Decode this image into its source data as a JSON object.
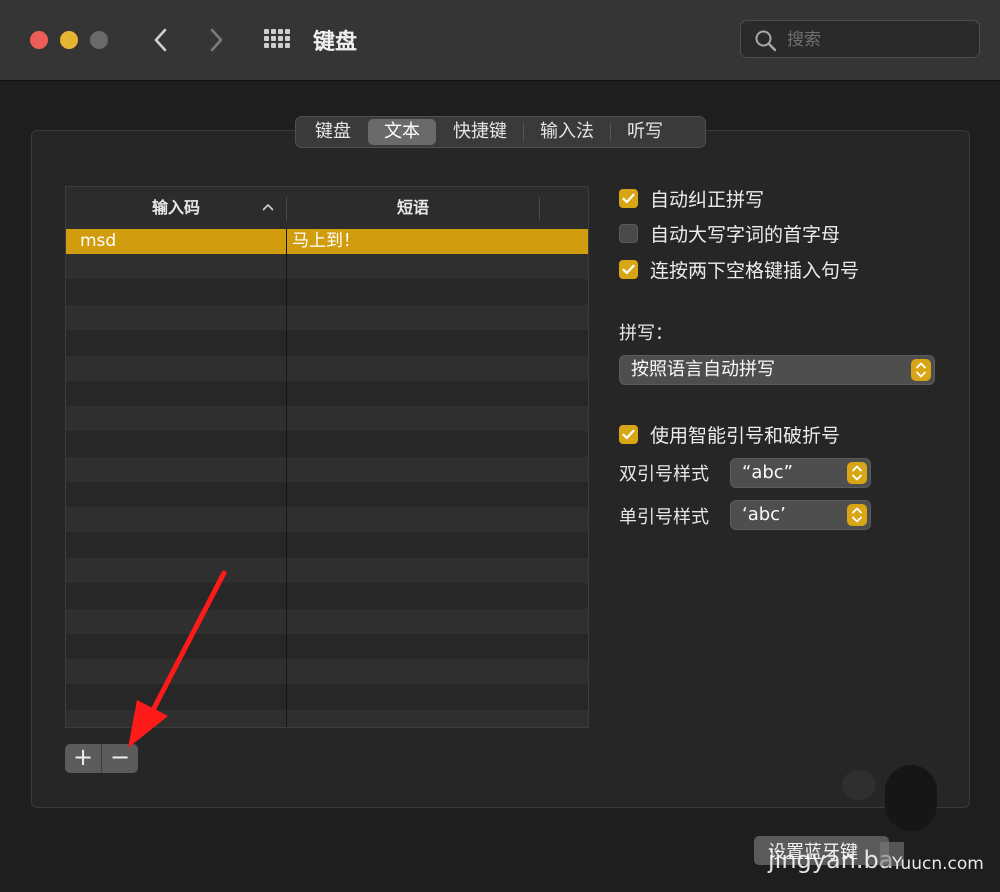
{
  "window": {
    "title": "键盘",
    "search_placeholder": "搜索"
  },
  "tabs": [
    {
      "label": "键盘",
      "active": false
    },
    {
      "label": "文本",
      "active": true
    },
    {
      "label": "快捷键",
      "active": false
    },
    {
      "label": "输入法",
      "active": false
    },
    {
      "label": "听写",
      "active": false
    }
  ],
  "table": {
    "columns": [
      "输入码",
      "短语"
    ],
    "rows": [
      {
        "input": "msd",
        "phrase": "马上到！",
        "selected": true
      }
    ]
  },
  "table_controls": {
    "add_label": "+",
    "remove_label": "−"
  },
  "options": {
    "autocorrect": {
      "label": "自动纠正拼写",
      "checked": true
    },
    "capitalize": {
      "label": "自动大写字词的首字母",
      "checked": false
    },
    "double_space_period": {
      "label": "连按两下空格键插入句号",
      "checked": true
    },
    "spelling_label": "拼写：",
    "spelling_value": "按照语言自动拼写",
    "smart_quotes": {
      "label": "使用智能引号和破折号",
      "checked": true
    },
    "double_quote_label": "双引号样式",
    "double_quote_value": "“abc”",
    "single_quote_label": "单引号样式",
    "single_quote_value": "‘abc’"
  },
  "bluetooth_button": "设置蓝牙键",
  "watermarks": {
    "primary": "jingyan.ba",
    "secondary": "Yuucn.com"
  },
  "colors": {
    "accent": "#d8a615",
    "selection": "#d29c0f",
    "annotation_arrow": "#ff1a1a"
  },
  "icons": [
    "back-chevron-icon",
    "forward-chevron-icon",
    "show-all-grid-icon",
    "search-icon",
    "checkmark-icon",
    "sort-ascending-icon",
    "popup-stepper-icon"
  ]
}
